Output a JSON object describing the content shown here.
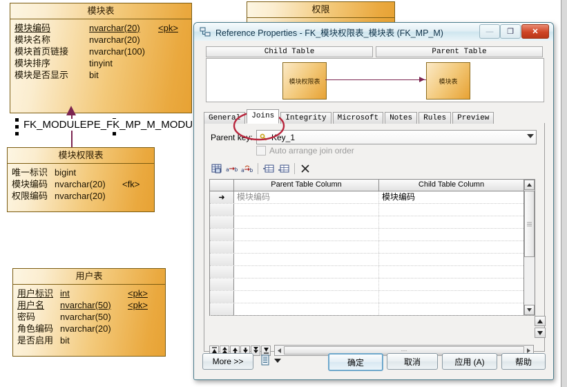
{
  "diagram": {
    "tables": [
      {
        "id": "module",
        "name": "模块表",
        "columns": [
          {
            "name": "模块编码",
            "type": "nvarchar(20)",
            "key": "<pk>",
            "pk": true
          },
          {
            "name": "模块名称",
            "type": "nvarchar(20)",
            "key": "",
            "pk": false
          },
          {
            "name": "模块首页链接",
            "type": "nvarchar(100)",
            "key": "",
            "pk": false
          },
          {
            "name": "模块排序",
            "type": "tinyint",
            "key": "",
            "pk": false
          },
          {
            "name": "模块是否显示",
            "type": "bit",
            "key": "",
            "pk": false
          }
        ]
      },
      {
        "id": "modperm",
        "name": "模块权限表",
        "columns": [
          {
            "name": "唯一标识",
            "type": "bigint",
            "key": "",
            "pk": false
          },
          {
            "name": "模块编码",
            "type": "nvarchar(20)",
            "key": "<fk>",
            "pk": false
          },
          {
            "name": "权限编码",
            "type": "nvarchar(20)",
            "key": "",
            "pk": false
          }
        ]
      },
      {
        "id": "user",
        "name": "用户表",
        "columns": [
          {
            "name": "用户标识",
            "type": "int",
            "key": "<pk>",
            "pk": true
          },
          {
            "name": "用户名",
            "type": "nvarchar(50)",
            "key": "<pk>",
            "pk": true
          },
          {
            "name": "密码",
            "type": "nvarchar(50)",
            "key": "",
            "pk": false
          },
          {
            "name": "角色编码",
            "type": "nvarchar(20)",
            "key": "",
            "pk": false
          },
          {
            "name": "是否启用",
            "type": "bit",
            "key": "",
            "pk": false
          }
        ]
      }
    ],
    "partial_table": {
      "name": "权限"
    },
    "relationship_label": "FK_MODULEPE_FK_MP_M_MODU",
    "colors": {
      "table_border": "#7a5b10",
      "table_fill_light": "#fdf6e3",
      "table_fill_dark": "#e7a234",
      "link": "#7b2450"
    }
  },
  "dialog": {
    "title": "Reference Properties - FK_模块权限表_模块表 (FK_MP_M)",
    "window_buttons": {
      "minimize": "—",
      "maximize": "❐",
      "close": "✕"
    },
    "preview": {
      "child_header": "Child Table",
      "parent_header": "Parent Table",
      "child_table": "模块权限表",
      "parent_table": "模块表"
    },
    "tabs": [
      {
        "label": "General",
        "active": false
      },
      {
        "label": "Joins",
        "active": true
      },
      {
        "label": "Integrity",
        "active": false
      },
      {
        "label": "Microsoft",
        "active": false
      },
      {
        "label": "Notes",
        "active": false
      },
      {
        "label": "Rules",
        "active": false
      },
      {
        "label": "Preview",
        "active": false
      }
    ],
    "parent_key": {
      "label": "Parent key:",
      "value": "Key_1"
    },
    "auto_arrange": {
      "label": "Auto arrange join order",
      "checked": false,
      "enabled": false
    },
    "grid": {
      "columns": [
        "Parent Table Column",
        "Child Table Column"
      ],
      "rows": [
        {
          "indicator": "➜",
          "parent_column": "模块编码",
          "child_column": "模块编码"
        }
      ],
      "empty_rows": 8
    },
    "toolbar_icons": [
      "grid-properties-icon",
      "add-join-icon",
      "edit-join-icon",
      "insert-row-icon",
      "add-row-icon",
      "delete-row-icon"
    ],
    "nav_icons": [
      "first-record-icon",
      "prev-page-icon",
      "prev-record-icon",
      "next-record-icon",
      "next-page-icon",
      "last-record-icon"
    ],
    "footer": {
      "more": "More >>",
      "menu_icon": "list-menu-icon",
      "ok": "确定",
      "cancel": "取消",
      "apply": "应用 (A)",
      "help": "帮助"
    },
    "annotation": {
      "shape": "red-ellipse",
      "target": "Joins",
      "color": "#b8253c"
    }
  }
}
